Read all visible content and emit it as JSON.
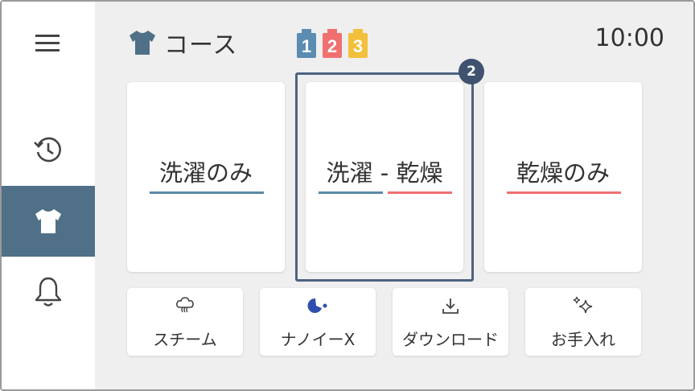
{
  "header": {
    "title": "コース",
    "time": "10:00",
    "badges": [
      {
        "label": "1",
        "color": "#5b8db3"
      },
      {
        "label": "2",
        "color": "#f07070"
      },
      {
        "label": "3",
        "color": "#f2c03c"
      }
    ]
  },
  "sidebar": {
    "items": [
      {
        "icon": "menu-icon",
        "active": false
      },
      {
        "icon": "history-icon",
        "active": false
      },
      {
        "icon": "shirt-icon",
        "active": true
      },
      {
        "icon": "bell-icon",
        "active": false
      }
    ]
  },
  "courses": [
    {
      "label": "洗濯のみ",
      "underline_colors": [
        "#5b8aa5"
      ]
    },
    {
      "label": "洗濯 - 乾燥",
      "underline_colors": [
        "#5b8aa5",
        "#f07070"
      ],
      "selected": true
    },
    {
      "label": "乾燥のみ",
      "underline_colors": [
        "#f07070"
      ]
    }
  ],
  "selected_step_badge": "2",
  "options": [
    {
      "label": "スチーム",
      "icon": "steam-icon"
    },
    {
      "label": "ナノイーX",
      "icon": "nanoe-icon"
    },
    {
      "label": "ダウンロード",
      "icon": "download-icon"
    },
    {
      "label": "お手入れ",
      "icon": "sparkle-icon"
    }
  ],
  "colors": {
    "accent": "#4f7087",
    "wash": "#5b8aa5",
    "dry": "#f07070",
    "selection": "#4e6281"
  }
}
